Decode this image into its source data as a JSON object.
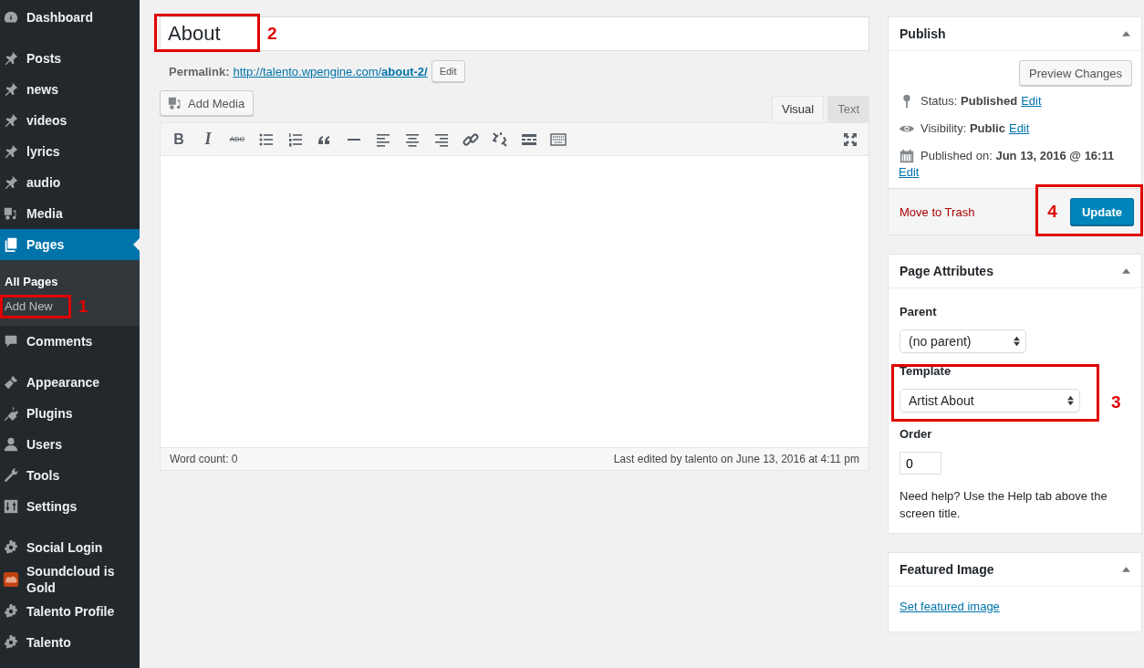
{
  "sidebar": {
    "groups": [
      [
        {
          "label": "Dashboard",
          "selected": false
        }
      ],
      [
        {
          "label": "Posts",
          "selected": false
        },
        {
          "label": "news",
          "selected": false
        },
        {
          "label": "videos",
          "selected": false
        },
        {
          "label": "lyrics",
          "selected": false
        },
        {
          "label": "audio",
          "selected": false
        },
        {
          "label": "Media",
          "selected": false
        },
        {
          "label": "Pages",
          "selected": true,
          "children": [
            {
              "label": "All Pages",
              "selected": true
            },
            {
              "label": "Add New",
              "selected": false,
              "annotation": "1"
            }
          ]
        },
        {
          "label": "Comments",
          "selected": false
        }
      ],
      [
        {
          "label": "Appearance",
          "selected": false
        },
        {
          "label": "Plugins",
          "selected": false
        },
        {
          "label": "Users",
          "selected": false
        },
        {
          "label": "Tools",
          "selected": false
        },
        {
          "label": "Settings",
          "selected": false
        }
      ],
      [
        {
          "label": "Social Login",
          "selected": false
        },
        {
          "label": "Soundcloud is Gold",
          "selected": false
        },
        {
          "label": "Talento Profile",
          "selected": false
        },
        {
          "label": "Talento",
          "selected": false
        }
      ]
    ]
  },
  "title_field": {
    "value": "About",
    "annotation": "2"
  },
  "permalink": {
    "label": "Permalink:",
    "url_base": "http://talento.wpengine.com/",
    "url_slug": "about-2/",
    "button": "Edit"
  },
  "add_media": "Add Media",
  "editor_tabs": [
    {
      "label": "Visual",
      "selected": true
    },
    {
      "label": "Text",
      "selected": false
    }
  ],
  "toolbar": [
    {
      "kind": "text",
      "label": "B"
    },
    {
      "kind": "text",
      "label": "I"
    },
    {
      "kind": "text",
      "label": "ABC"
    },
    {
      "kind": "icon"
    },
    {
      "kind": "icon"
    },
    {
      "kind": "icon"
    },
    {
      "kind": "icon"
    },
    {
      "kind": "icon"
    },
    {
      "kind": "icon"
    },
    {
      "kind": "icon"
    },
    {
      "kind": "icon"
    },
    {
      "kind": "icon"
    },
    {
      "kind": "icon"
    },
    {
      "kind": "icon"
    }
  ],
  "status_bar": {
    "word_count": "Word count: 0",
    "last_edited": "Last edited by talento on June 13, 2016 at 4:11 pm"
  },
  "publish": {
    "title": "Publish",
    "preview_button": "Preview Changes",
    "rows": [
      {
        "label": "Status:",
        "value": "Published",
        "link": "Edit"
      },
      {
        "label": "Visibility:",
        "value": "Public",
        "link": "Edit"
      },
      {
        "label": "Published on:",
        "value": "Jun 13, 2016 @ 16:11",
        "link": "Edit"
      }
    ],
    "trash": "Move to Trash",
    "update_button": "Update",
    "annotation": "4"
  },
  "page_attributes": {
    "title": "Page Attributes",
    "parent_label": "Parent",
    "parent_value": "(no parent)",
    "template_label": "Template",
    "template_value": "Artist About",
    "template_annotation": "3",
    "order_label": "Order",
    "order_value": "0",
    "help": "Need help? Use the Help tab above the screen title."
  },
  "featured_image": {
    "title": "Featured Image",
    "link": "Set featured image"
  }
}
